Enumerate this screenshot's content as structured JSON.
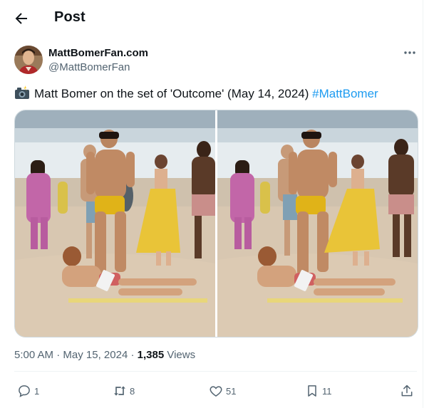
{
  "header": {
    "title": "Post",
    "back_icon": "arrow-left-icon"
  },
  "author": {
    "display_name": "MattBomerFan.com",
    "handle": "@MattBomerFan",
    "more_icon": "more-horizontal-icon"
  },
  "tweet": {
    "emoji": "camera-with-flash-icon",
    "text": "Matt Bomer on the set of 'Outcome' (May 14, 2024)",
    "hashtag": "#MattBomer"
  },
  "media": {
    "count": 2,
    "subject": "beach-photo"
  },
  "meta": {
    "time": "5:00 AM",
    "sep": "·",
    "date": "May 15, 2024",
    "views_count": "1,385",
    "views_label": "Views"
  },
  "actions": {
    "reply": {
      "icon": "reply-icon",
      "count": "1"
    },
    "repost": {
      "icon": "repost-icon",
      "count": "8"
    },
    "like": {
      "icon": "heart-icon",
      "count": "51"
    },
    "bookmark": {
      "icon": "bookmark-icon",
      "count": "11"
    },
    "share": {
      "icon": "share-icon"
    }
  },
  "colors": {
    "link": "#1d9bf0",
    "secondary": "#536471",
    "border": "#cfd9de"
  }
}
